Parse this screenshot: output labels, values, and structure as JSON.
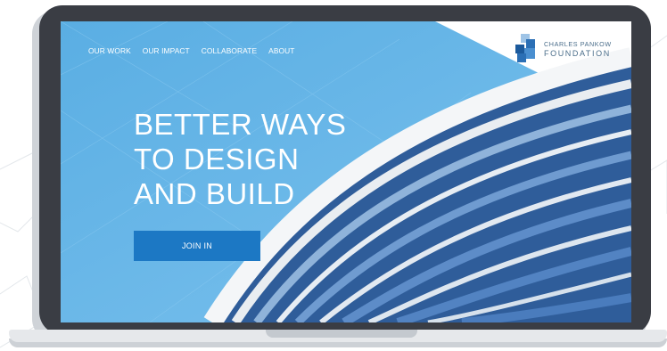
{
  "nav": {
    "items": [
      "OUR WORK",
      "OUR IMPACT",
      "COLLABORATE",
      "ABOUT"
    ]
  },
  "logo": {
    "line1": "CHARLES PANKOW",
    "line2": "FOUNDATION",
    "icon": "building-blocks-icon"
  },
  "hero": {
    "line1": "BETTER WAYS",
    "line2": "TO DESIGN",
    "line3": "AND BUILD"
  },
  "cta": {
    "label": "JOIN IN"
  },
  "colors": {
    "sky": "#63b4e6",
    "cta": "#1c78c4",
    "bezel": "#3a3d44",
    "logo_blue": "#2b6fb5"
  }
}
